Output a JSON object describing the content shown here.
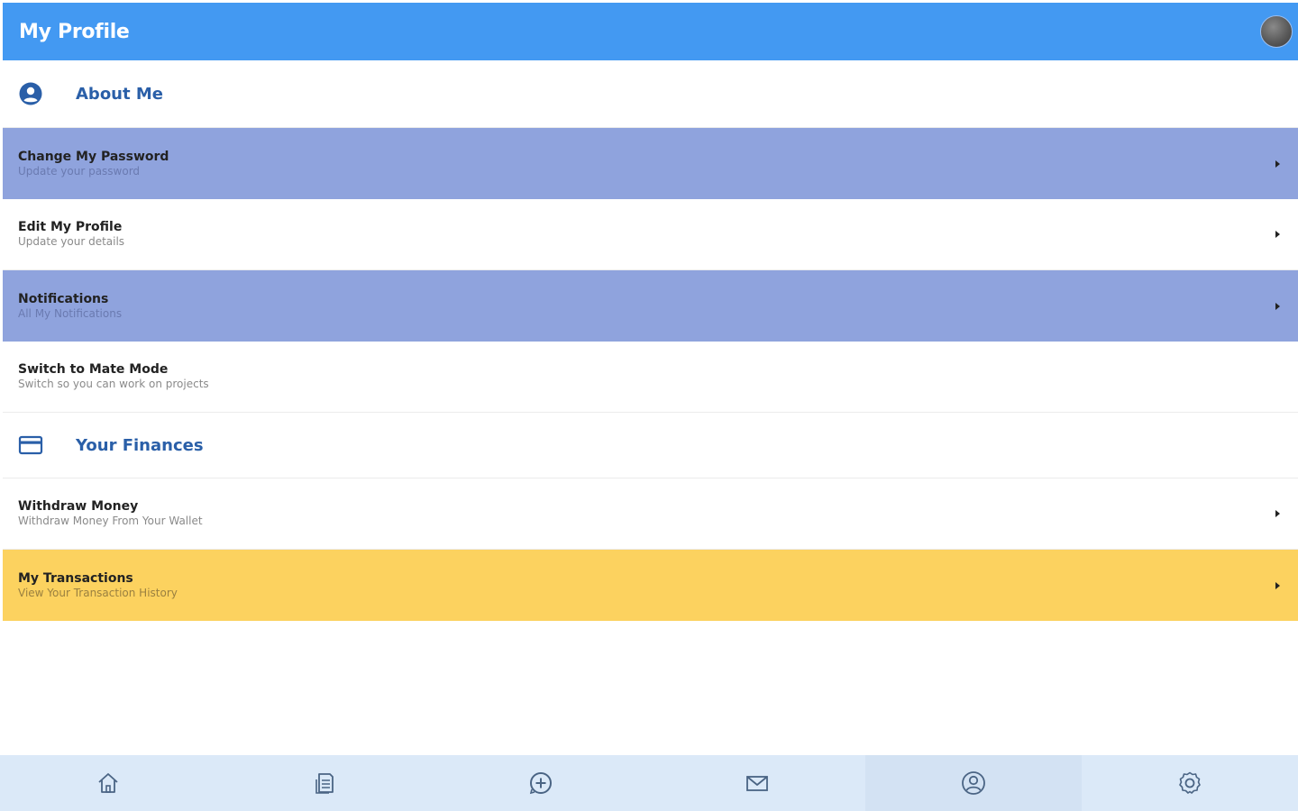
{
  "header": {
    "title": "My Profile"
  },
  "sections": {
    "about": {
      "title": "About Me",
      "icon": "user-circle-icon"
    },
    "finances": {
      "title": "Your Finances",
      "icon": "credit-card-icon"
    }
  },
  "about_items": [
    {
      "title": "Change My Password",
      "subtitle": "Update your password"
    },
    {
      "title": "Edit My Profile",
      "subtitle": "Update your details"
    },
    {
      "title": "Notifications",
      "subtitle": "All My Notifications"
    },
    {
      "title": "Switch to Mate Mode",
      "subtitle": "Switch so you can work on projects"
    }
  ],
  "finance_items": [
    {
      "title": "Withdraw Money",
      "subtitle": "Withdraw Money From Your Wallet"
    },
    {
      "title": "My Transactions",
      "subtitle": "View Your Transaction History"
    }
  ],
  "bottom_nav": [
    {
      "icon": "home-icon"
    },
    {
      "icon": "document-icon"
    },
    {
      "icon": "add-circle-icon"
    },
    {
      "icon": "mail-icon"
    },
    {
      "icon": "profile-icon",
      "active": true
    },
    {
      "icon": "settings-icon"
    }
  ],
  "colors": {
    "header": "#4399f2",
    "highlight_purple": "#8fa3dd",
    "highlight_yellow": "#fcd25f",
    "section_title": "#2a5fa8",
    "nav_background": "#dbe9f8"
  }
}
